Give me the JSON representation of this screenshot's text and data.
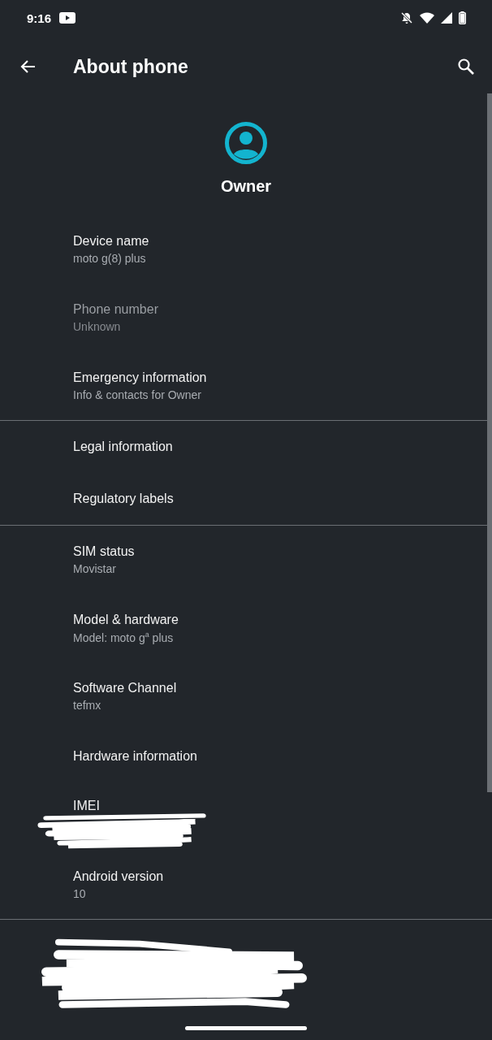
{
  "status_bar": {
    "time": "9:16"
  },
  "toolbar": {
    "title": "About phone"
  },
  "header": {
    "name": "Owner"
  },
  "sections": [
    {
      "kind": "list",
      "items": [
        {
          "title": "Device name",
          "summary": "moto g(8) plus",
          "disabled": false
        },
        {
          "title": "Phone number",
          "summary": "Unknown",
          "disabled": true
        },
        {
          "title": "Emergency information",
          "summary": "Info & contacts for Owner",
          "disabled": false
        }
      ]
    },
    {
      "kind": "list",
      "items": [
        {
          "title": "Legal information",
          "disabled": false
        },
        {
          "title": "Regulatory labels",
          "disabled": false
        }
      ]
    },
    {
      "kind": "list",
      "items": [
        {
          "title": "SIM status",
          "summary": "Movistar",
          "disabled": false
        },
        {
          "title": "Model & hardware",
          "summary": "Model: moto g$^{a}$ plus",
          "disabled": false
        },
        {
          "title": "Software Channel",
          "summary": "tefmx",
          "disabled": false
        },
        {
          "title": "Hardware information",
          "disabled": false
        },
        {
          "title": "IMEI",
          "disabled": false,
          "redacted": true
        },
        {
          "title": "Android version",
          "summary": "10",
          "disabled": false
        }
      ]
    },
    {
      "kind": "redacted"
    }
  ]
}
